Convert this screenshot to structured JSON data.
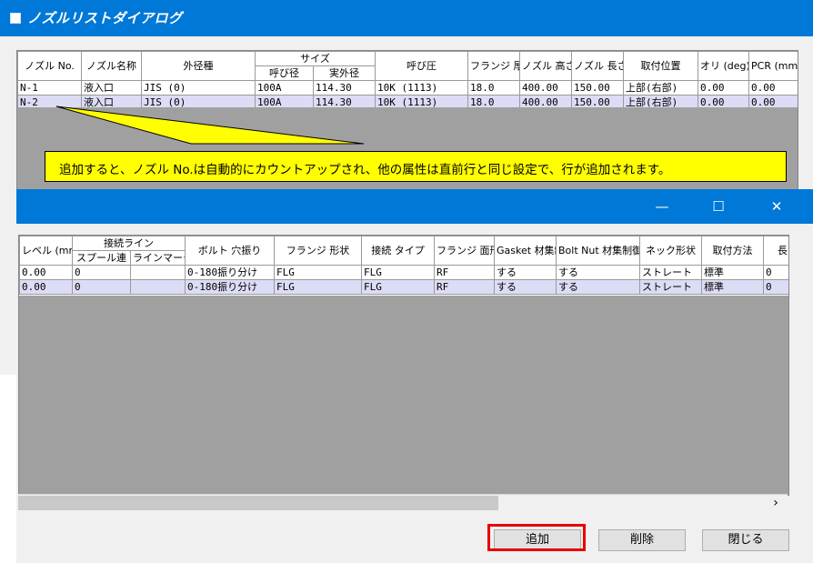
{
  "window1": {
    "title": "ノズルリストダイアログ",
    "columns": {
      "nozzle_no": "ノズル No.",
      "nozzle_name": "ノズル名称",
      "outer_dia_type": "外径種",
      "size": "サイズ",
      "nominal": "呼び径",
      "actual_od": "実外径",
      "pressure": "呼び圧",
      "flange_thk": "フランジ 厚さ(mm)",
      "nozzle_height": "ノズル 高さ(mm)",
      "nozzle_length": "ノズル 長さ(mm)",
      "mount_pos": "取付位置",
      "ori": "オリ (deg)",
      "pcr": "PCR (mm)"
    },
    "rows": [
      [
        "N-1",
        "液入口",
        "JIS (0)",
        "100A",
        "114.30",
        "10K (1113)",
        "18.0",
        "400.00",
        "150.00",
        "上部(右部)",
        "0.00",
        "0.00"
      ],
      [
        "N-2",
        "液入口",
        "JIS (0)",
        "100A",
        "114.30",
        "10K (1113)",
        "18.0",
        "400.00",
        "150.00",
        "上部(右部)",
        "0.00",
        "0.00"
      ]
    ]
  },
  "callout": {
    "text": "追加すると、ノズル No.は自動的にカウントアップされ、他の属性は直前行と同じ設定で、行が追加されます。"
  },
  "window2": {
    "caption_buttons": {
      "minimize": "—",
      "maximize": "☐",
      "close": "✕"
    },
    "columns": {
      "level": "レベル (mm)",
      "connection_line": "接続ライン",
      "spool_link": "スプール連",
      "line_mark": "ラインマーク",
      "bolt_hole": "ボルト 穴振り",
      "flange_shape": "フランジ 形状",
      "conn_type": "接続 タイプ",
      "flange_face": "フランジ 面形式",
      "gasket_ctrl": "Gasket 材集制御",
      "boltnut_ctrl": "Bolt Nut 材集制御",
      "neck_shape": "ネック形状",
      "mount_method": "取付方法",
      "length_partial": "長"
    },
    "rows": [
      [
        "0.00",
        "0",
        "",
        "0-180振り分け",
        "FLG",
        "FLG",
        "RF",
        "する",
        "する",
        "ストレート",
        "標準",
        "0"
      ],
      [
        "0.00",
        "0",
        "",
        "0-180振り分け",
        "FLG",
        "FLG",
        "RF",
        "する",
        "する",
        "ストレート",
        "標準",
        "0"
      ]
    ],
    "buttons": {
      "add": "追加",
      "delete": "削除",
      "close": "閉じる"
    },
    "scroll_right": "›"
  },
  "colors": {
    "titlebar": "#0078d7",
    "callout": "#ffff00",
    "highlight": "#e60000",
    "selected_row": "#dcdcf6"
  }
}
